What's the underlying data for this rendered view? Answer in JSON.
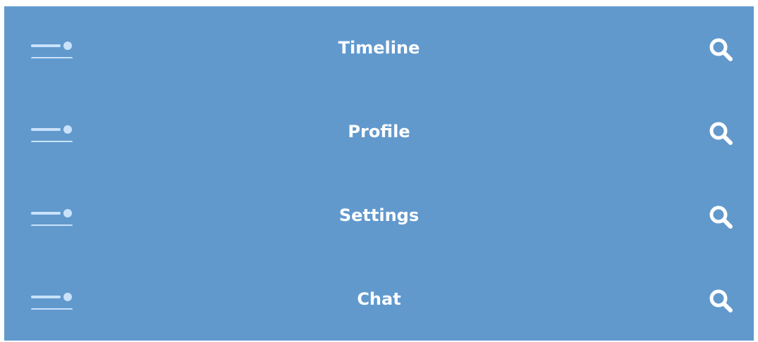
{
  "colors": {
    "panel_background": "#6199cd",
    "text": "#ffffff",
    "menu_icon": "#c9e2fa",
    "search_icon": "#ffffff"
  },
  "rows": [
    {
      "title": "Timeline",
      "left_icon": "menu-icon",
      "right_icon": "search-icon"
    },
    {
      "title": "Profile",
      "left_icon": "menu-icon",
      "right_icon": "search-icon"
    },
    {
      "title": "Settings",
      "left_icon": "menu-icon",
      "right_icon": "search-icon"
    },
    {
      "title": "Chat",
      "left_icon": "menu-icon",
      "right_icon": "search-icon"
    }
  ]
}
